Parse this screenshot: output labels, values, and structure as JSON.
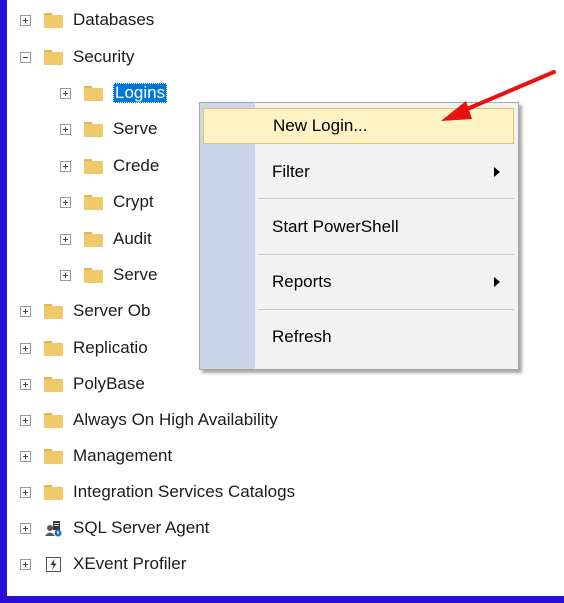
{
  "tree": {
    "items": [
      {
        "label": "Databases",
        "expander": "plus",
        "icon": "folder-icon",
        "level": 0
      },
      {
        "label": "Security",
        "expander": "minus",
        "icon": "folder-icon",
        "level": 0
      },
      {
        "label": "Logins",
        "expander": "plus",
        "icon": "folder-icon",
        "level": 1,
        "selected": true
      },
      {
        "label": "Serve",
        "expander": "plus",
        "icon": "folder-icon",
        "level": 1
      },
      {
        "label": "Crede",
        "expander": "plus",
        "icon": "folder-icon",
        "level": 1
      },
      {
        "label": "Crypt",
        "expander": "plus",
        "icon": "folder-icon",
        "level": 1
      },
      {
        "label": "Audit",
        "expander": "plus",
        "icon": "folder-icon",
        "level": 1
      },
      {
        "label": "Serve",
        "expander": "plus",
        "icon": "folder-icon",
        "level": 1
      },
      {
        "label": "Server Ob",
        "expander": "plus",
        "icon": "folder-icon",
        "level": 0
      },
      {
        "label": "Replicatio",
        "expander": "plus",
        "icon": "folder-icon",
        "level": 0
      },
      {
        "label": "PolyBase",
        "expander": "plus",
        "icon": "folder-icon",
        "level": 0
      },
      {
        "label": "Always On High Availability",
        "expander": "plus",
        "icon": "folder-icon",
        "level": 0
      },
      {
        "label": "Management",
        "expander": "plus",
        "icon": "folder-icon",
        "level": 0
      },
      {
        "label": "Integration Services Catalogs",
        "expander": "plus",
        "icon": "folder-icon",
        "level": 0
      },
      {
        "label": "SQL Server Agent",
        "expander": "plus",
        "icon": "sql-agent-icon",
        "level": 0
      },
      {
        "label": "XEvent Profiler",
        "expander": "plus",
        "icon": "xevent-icon",
        "level": 0
      }
    ]
  },
  "context_menu": {
    "items": [
      {
        "label": "New Login...",
        "highlighted": true,
        "submenu": false
      },
      {
        "label": "Filter",
        "submenu": true
      },
      {
        "label": "Start PowerShell",
        "submenu": false
      },
      {
        "label": "Reports",
        "submenu": true
      },
      {
        "label": "Refresh",
        "submenu": false
      }
    ]
  },
  "colors": {
    "frame": "#2a0fd6",
    "selection": "#0078d7",
    "menu_highlight": "#fdf3c4",
    "arrow": "#e81010"
  }
}
